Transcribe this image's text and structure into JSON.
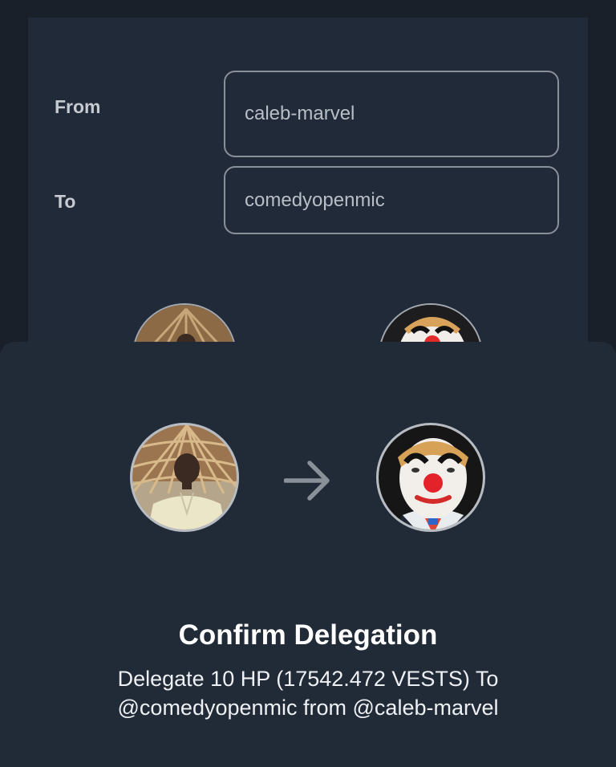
{
  "form": {
    "from_label": "From",
    "from_value": "caleb-marvel",
    "to_label": "To",
    "to_value": "comedyopenmic"
  },
  "confirm_sheet": {
    "title": "Confirm Delegation",
    "description_line1": "Delegate 10 HP (17542.472 VESTS) To",
    "description_line2": "@comedyopenmic from @caleb-marvel",
    "from_avatar_icon": "user-avatar-caleb-marvel",
    "to_avatar_icon": "user-avatar-comedyopenmic",
    "arrow_icon": "arrow-right-icon"
  },
  "colors": {
    "background": "#1a202a",
    "card": "#202a38",
    "sheet": "#212a37",
    "text_primary": "#ffffff",
    "input_border": "#8a9099"
  }
}
